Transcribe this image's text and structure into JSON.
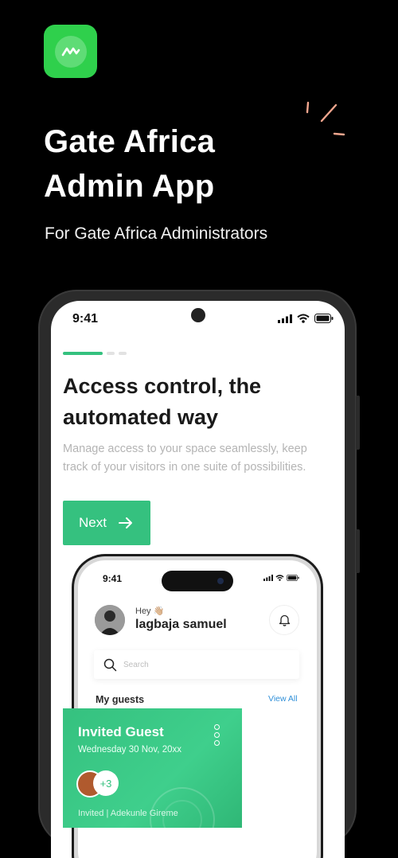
{
  "header": {
    "title_line1": "Gate Africa",
    "title_line2": "Admin App",
    "subtitle": "For Gate Africa Administrators"
  },
  "colors": {
    "brand_green": "#2fd04c",
    "accent": "#35c17f",
    "link": "#2f8fd8"
  },
  "device": {
    "time": "9:41",
    "onboarding": {
      "step": 1,
      "total_steps": 3,
      "headline_line1": "Access control, the",
      "headline_line2": "automated way",
      "description": "Manage access to your space seamlessly, keep track of your visitors in one suite of possibilities.",
      "next_label": "Next",
      "next_icon": "arrow-right-icon"
    }
  },
  "inner_device": {
    "time": "9:41",
    "greeting": "Hey 👋🏼",
    "user_name": "lagbaja samuel",
    "search_placeholder": "Search",
    "section_title": "My guests",
    "view_all": "View All",
    "card": {
      "title": "Invited Guest",
      "date": "Wednesday 30 Nov, 20xx",
      "extra_count": "+3",
      "footer": "Invited | Adekunle Gireme"
    }
  }
}
